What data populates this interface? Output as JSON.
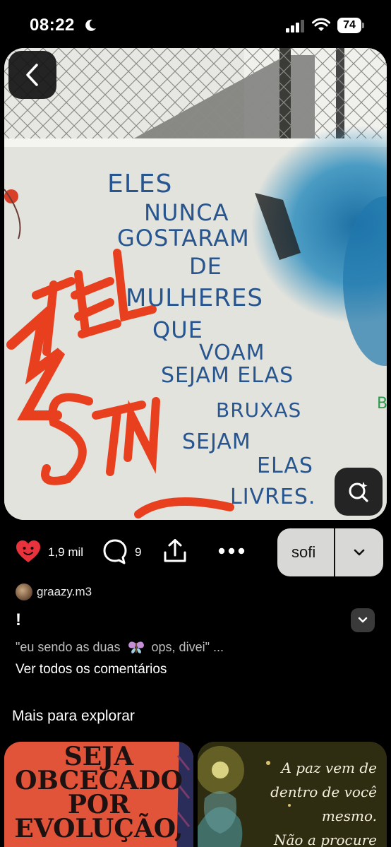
{
  "status_bar": {
    "time": "08:22",
    "battery": "74",
    "icons": [
      "moon-icon",
      "signal-icon",
      "wifi-icon",
      "battery-icon"
    ]
  },
  "pin": {
    "image_text": {
      "lines": [
        "ELES",
        "NUNCA",
        "GOSTARAM",
        "DE",
        "MULHERES",
        "QUE",
        "VOAM",
        "SEJAM ELAS",
        "BRUXAS",
        "SEJAM",
        "ELAS",
        "LIVRES."
      ],
      "graffiti": [
        "BIEL",
        "STN"
      ]
    },
    "back_icon": "chevron-left-icon",
    "visual_search_icon": "visual-search-icon"
  },
  "actions": {
    "likes": "1,9 mil",
    "comments": "9",
    "board_name": "sofi",
    "icons": [
      "heart-icon",
      "comment-icon",
      "share-icon",
      "more-icon",
      "chevron-down-icon"
    ]
  },
  "details": {
    "creator": "graazy.m3",
    "title": "!",
    "comment_before": "\"eu sendo as duas",
    "comment_after": "ops, divei\" ...",
    "view_comments": "Ver todos os comentários"
  },
  "explore": {
    "heading": "Mais para explorar",
    "cards": [
      {
        "text": "SEJA\nOBCECADO\nPOR\nEVOLUÇÃO,"
      },
      {
        "text": "A paz vem de\ndentro de você\nmesmo.\nNão a procure"
      }
    ]
  },
  "colors": {
    "background": "#000000",
    "heart": "#e8323c",
    "wall_text": "#27558f",
    "graffiti": "#e8401f"
  }
}
